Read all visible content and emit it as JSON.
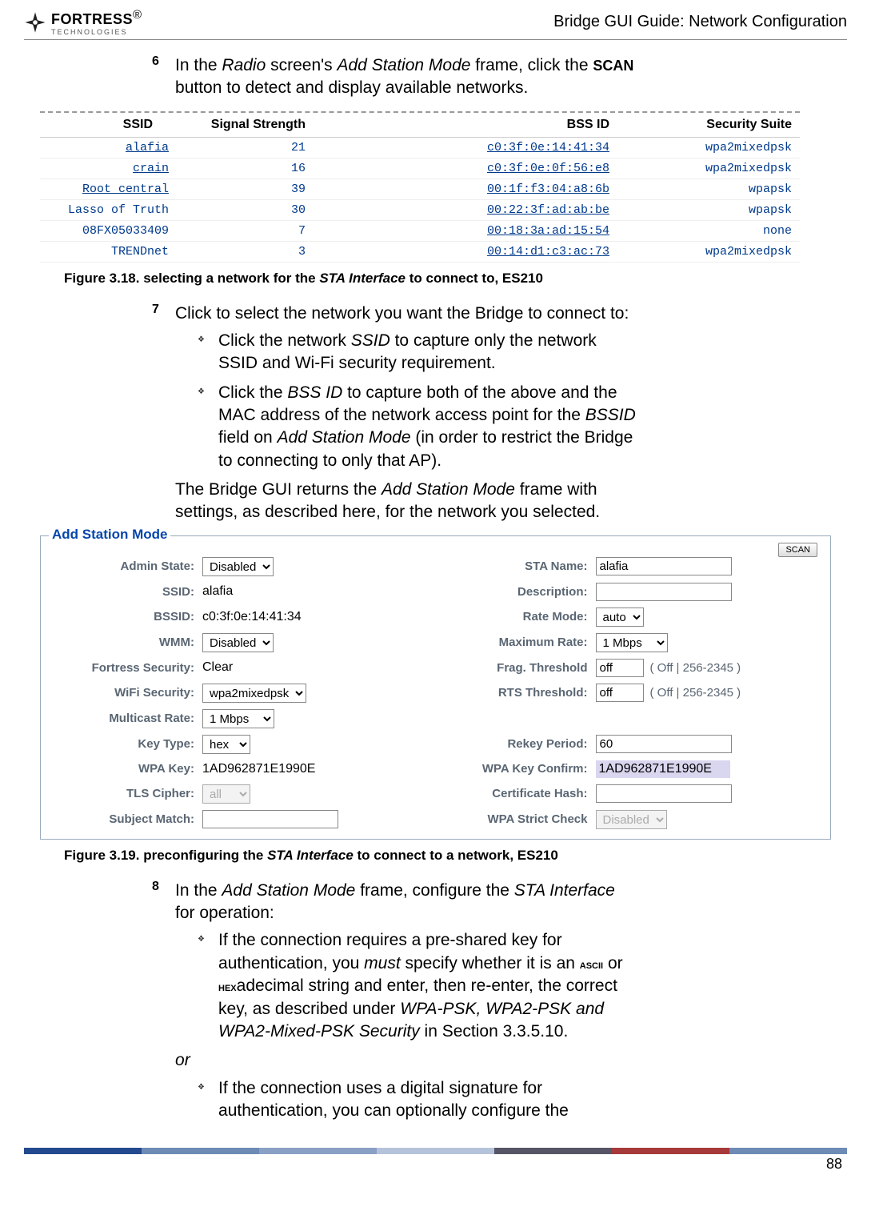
{
  "header": {
    "logo_main": "FORTRESS",
    "logo_sub": "TECHNOLOGIES",
    "logo_reg": "®",
    "title": "Bridge GUI Guide: Network Configuration"
  },
  "step6": {
    "num": "6",
    "text_a": "In the ",
    "radio": "Radio",
    "text_b": " screen's ",
    "asm": "Add Station Mode",
    "text_c": " frame, click the ",
    "scan": "SCAN",
    "text_d": " button to detect and display available networks."
  },
  "scan_headers": {
    "ssid": "SSID",
    "sig": "Signal Strength",
    "bss": "BSS ID",
    "sec": "Security Suite"
  },
  "scan_rows": [
    {
      "ssid": "alafia",
      "sig": "21",
      "bss": "c0:3f:0e:14:41:34",
      "sec": "wpa2mixedpsk",
      "link": true
    },
    {
      "ssid": "crain",
      "sig": "16",
      "bss": "c0:3f:0e:0f:56:e8",
      "sec": "wpa2mixedpsk",
      "link": true
    },
    {
      "ssid": "Root central",
      "sig": "39",
      "bss": "00:1f:f3:04:a8:6b",
      "sec": "wpapsk",
      "link": true
    },
    {
      "ssid": "Lasso of Truth",
      "sig": "30",
      "bss": "00:22:3f:ad:ab:be",
      "sec": "wpapsk",
      "link": false
    },
    {
      "ssid": "08FX05033409",
      "sig": "7",
      "bss": "00:18:3a:ad:15:54",
      "sec": "none",
      "link": false
    },
    {
      "ssid": "TRENDnet",
      "sig": "3",
      "bss": "00:14:d1:c3:ac:73",
      "sec": "wpa2mixedpsk",
      "link": false
    }
  ],
  "fig318": {
    "label": "Figure 3.18. selecting a network for the ",
    "it": "STA Interface",
    "tail": " to connect to, ES210"
  },
  "step7": {
    "num": "7",
    "intro": "Click to select the network you want the Bridge to connect to:",
    "b1a": "Click the network ",
    "b1it": "SSID",
    "b1b": " to capture only the network SSID and Wi-Fi security requirement.",
    "b2a": "Click the ",
    "b2it1": "BSS ID",
    "b2b": " to capture both of the above and the MAC address of the network access point for the ",
    "b2it2": "BSSID",
    "b2c": " field on ",
    "b2it3": "Add Station Mode",
    "b2d": " (in order to restrict the Bridge to connecting to only that AP).",
    "outro_a": "The Bridge GUI returns the ",
    "outro_it": "Add Station Mode",
    "outro_b": " frame with settings, as described here, for the network you selected."
  },
  "asm_panel": {
    "legend": "Add Station Mode",
    "scan_btn": "SCAN",
    "labels": {
      "admin_state": "Admin State:",
      "ssid": "SSID:",
      "bssid": "BSSID:",
      "wmm": "WMM:",
      "fortress": "Fortress Security:",
      "wifi_sec": "WiFi Security:",
      "mc_rate": "Multicast Rate:",
      "key_type": "Key Type:",
      "wpa_key": "WPA Key:",
      "tls": "TLS Cipher:",
      "subj": "Subject Match:",
      "sta_name": "STA Name:",
      "desc": "Description:",
      "rate_mode": "Rate Mode:",
      "max_rate": "Maximum Rate:",
      "frag": "Frag. Threshold",
      "rts": "RTS Threshold:",
      "rekey": "Rekey Period:",
      "wpa_conf": "WPA Key Confirm:",
      "cert": "Certificate Hash:",
      "strict": "WPA Strict Check"
    },
    "values": {
      "admin_state": "Disabled",
      "ssid": "alafia",
      "bssid": "c0:3f:0e:14:41:34",
      "wmm": "Disabled",
      "fortress": "Clear",
      "wifi_sec": "wpa2mixedpsk",
      "mc_rate": "1 Mbps",
      "key_type": "hex",
      "wpa_key": "1AD962871E1990E",
      "tls": "all",
      "subj": "",
      "sta_name": "alafia",
      "desc": "",
      "rate_mode": "auto",
      "max_rate": "1 Mbps",
      "frag": "off",
      "rts": "off",
      "rekey": "60",
      "wpa_conf": "1AD962871E1990E",
      "cert": "",
      "strict": "Disabled",
      "thresh_hint": "( Off | 256-2345 )"
    }
  },
  "fig319": {
    "label": "Figure 3.19. preconfiguring the ",
    "it": "STA Interface",
    "tail": " to connect to a network, ES210"
  },
  "step8": {
    "num": "8",
    "intro_a": "In the ",
    "intro_it1": "Add Station Mode",
    "intro_b": " frame, configure the ",
    "intro_it2": "STA Interface",
    "intro_c": " for operation:",
    "b1a": "If the connection requires a pre-shared key for authentication, you ",
    "b1it": "must",
    "b1b": " specify whether it is an ",
    "b1sc1": "ascii",
    "b1c": " or ",
    "b1sc2": "hex",
    "b1d": "adecimal string and enter, then re-enter, the correct key, as described under ",
    "b1it2": "WPA-PSK, WPA2-PSK and WPA2-Mixed-PSK Security",
    "b1e": " in Section 3.3.5.10.",
    "or": "or",
    "b2": "If the connection uses a digital signature for authentication, you can optionally configure the"
  },
  "page_num": "88"
}
